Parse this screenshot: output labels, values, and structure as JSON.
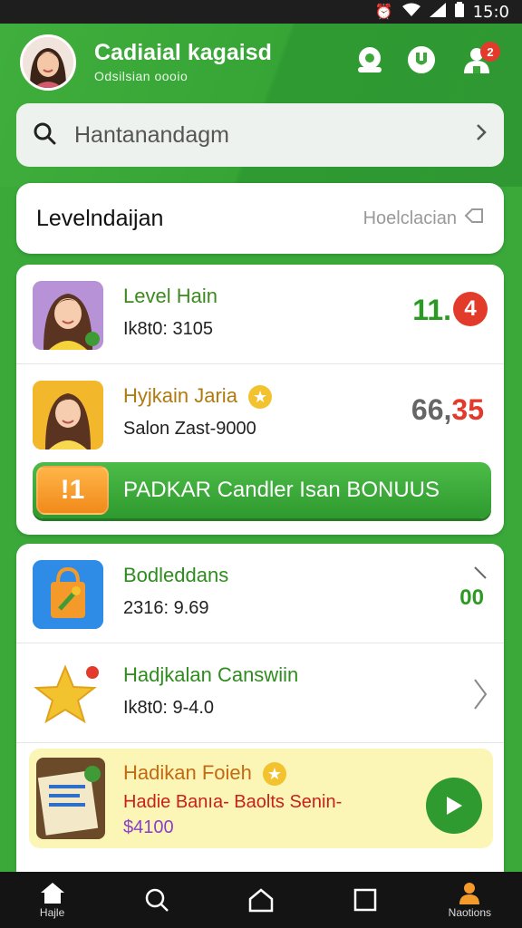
{
  "status_bar": {
    "time": "15:0"
  },
  "header": {
    "title": "Cadiaial kagaisd",
    "subtitle": "Odsilsian oooio",
    "notification_count": "2"
  },
  "search": {
    "placeholder": "Hantanandagm"
  },
  "level_section": {
    "title": "Levelndaijan",
    "link": "Hoelclacian"
  },
  "level_rows": [
    {
      "title": "Level Hain",
      "subtitle": "Ik8t0: 3105",
      "value": "11.",
      "badge": "4",
      "title_color": "#3c8a1f"
    },
    {
      "title": "Hyjkain Jaria",
      "subtitle": "Salon Zast-9000",
      "value_a": "66,",
      "value_b": "35",
      "title_color": "#b07a10"
    }
  ],
  "bonus_button": {
    "icon_text": "!1",
    "label": "PADKAR Candler Isan BONUUS"
  },
  "reward_rows": [
    {
      "title": "Bodleddans",
      "subtitle": "2316: 9.69",
      "value": "00",
      "title_color": "#2f8c1e"
    },
    {
      "title": "Hadjkalan Canswiin",
      "subtitle": "Ik8t0: 9-4.0",
      "title_color": "#2f8c1e"
    }
  ],
  "promo": {
    "title": "Hadikan Foieh",
    "subtitle": "Hadie Banıa- Baolts Senin-",
    "price": "$4100"
  },
  "bottom_nav": [
    {
      "label": "Hajle",
      "icon": "home-icon"
    },
    {
      "label": "",
      "icon": "search-icon"
    },
    {
      "label": "",
      "icon": "house-outline-icon"
    },
    {
      "label": "",
      "icon": "square-icon"
    },
    {
      "label": "Naotions",
      "icon": "profile-icon"
    }
  ],
  "colors": {
    "brand_green": "#3aa93a",
    "value_green": "#2a9a22",
    "alert_red": "#e23b2c",
    "gold": "#f3c22f"
  }
}
